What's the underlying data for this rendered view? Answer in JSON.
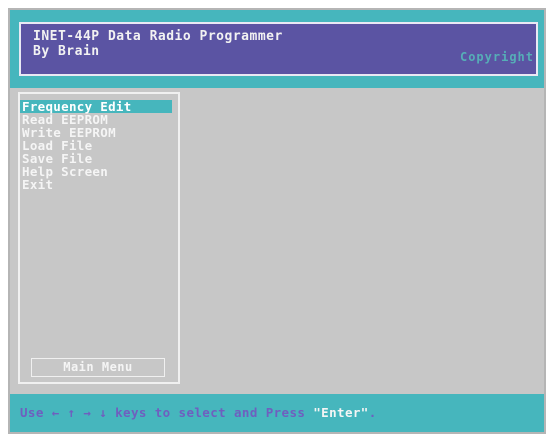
{
  "title": {
    "line1": "INET-44P Data Radio Programmer",
    "line2": "By Brain",
    "copyright": "Copyright"
  },
  "menu": {
    "items": [
      {
        "label": "Frequency Edit",
        "selected": true
      },
      {
        "label": "Read EEPROM",
        "selected": false
      },
      {
        "label": "Write EEPROM",
        "selected": false
      },
      {
        "label": "Load File",
        "selected": false
      },
      {
        "label": "Save File",
        "selected": false
      },
      {
        "label": "Help Screen",
        "selected": false
      },
      {
        "label": "Exit",
        "selected": false
      }
    ],
    "caption": "Main Menu"
  },
  "status": {
    "prefix": "Use ← ↑ → ↓ keys to select and Press ",
    "key": "\"Enter\"",
    "suffix": "."
  },
  "colors": {
    "accent_cyan": "#46b6bd",
    "title_purple": "#5b54a3",
    "workspace_gray": "#c7c7c7"
  }
}
